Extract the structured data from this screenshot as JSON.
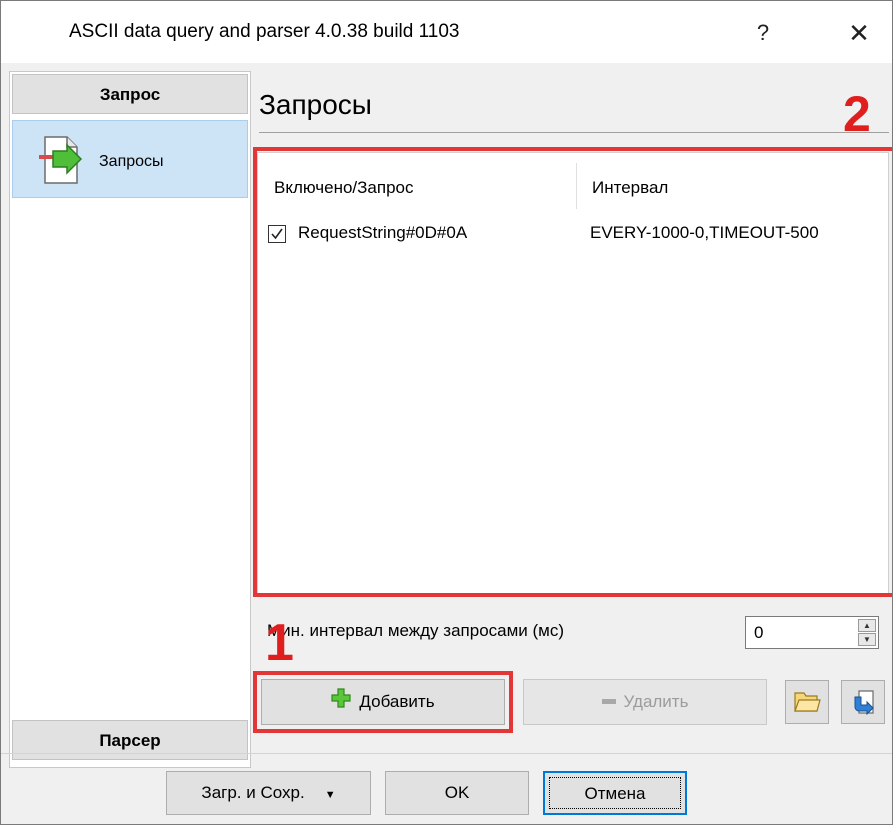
{
  "window": {
    "title": "ASCII data query and parser 4.0.38 build 1103",
    "help_glyph": "?",
    "close_glyph": "✕"
  },
  "sidebar": {
    "section_top": "Запрос",
    "items": [
      {
        "label": "Запросы",
        "icon": "document-arrow-icon",
        "selected": true
      }
    ],
    "section_bottom": "Парсер"
  },
  "main": {
    "title": "Запросы",
    "table": {
      "columns": [
        "Включено/Запрос",
        "Интервал"
      ],
      "rows": [
        {
          "enabled": true,
          "request": "RequestString#0D#0A",
          "interval": "EVERY-1000-0,TIMEOUT-500"
        }
      ]
    },
    "min_interval": {
      "label": "Мин. интервал между запросами (мс)",
      "value": "0"
    },
    "buttons": {
      "add": "Добавить",
      "delete": "Удалить"
    },
    "annotations": {
      "marker1": "1",
      "marker2": "2",
      "color": "#e33737"
    }
  },
  "footer": {
    "load_save": "Загр. и Сохр.",
    "ok": "OK",
    "cancel": "Отмена"
  }
}
